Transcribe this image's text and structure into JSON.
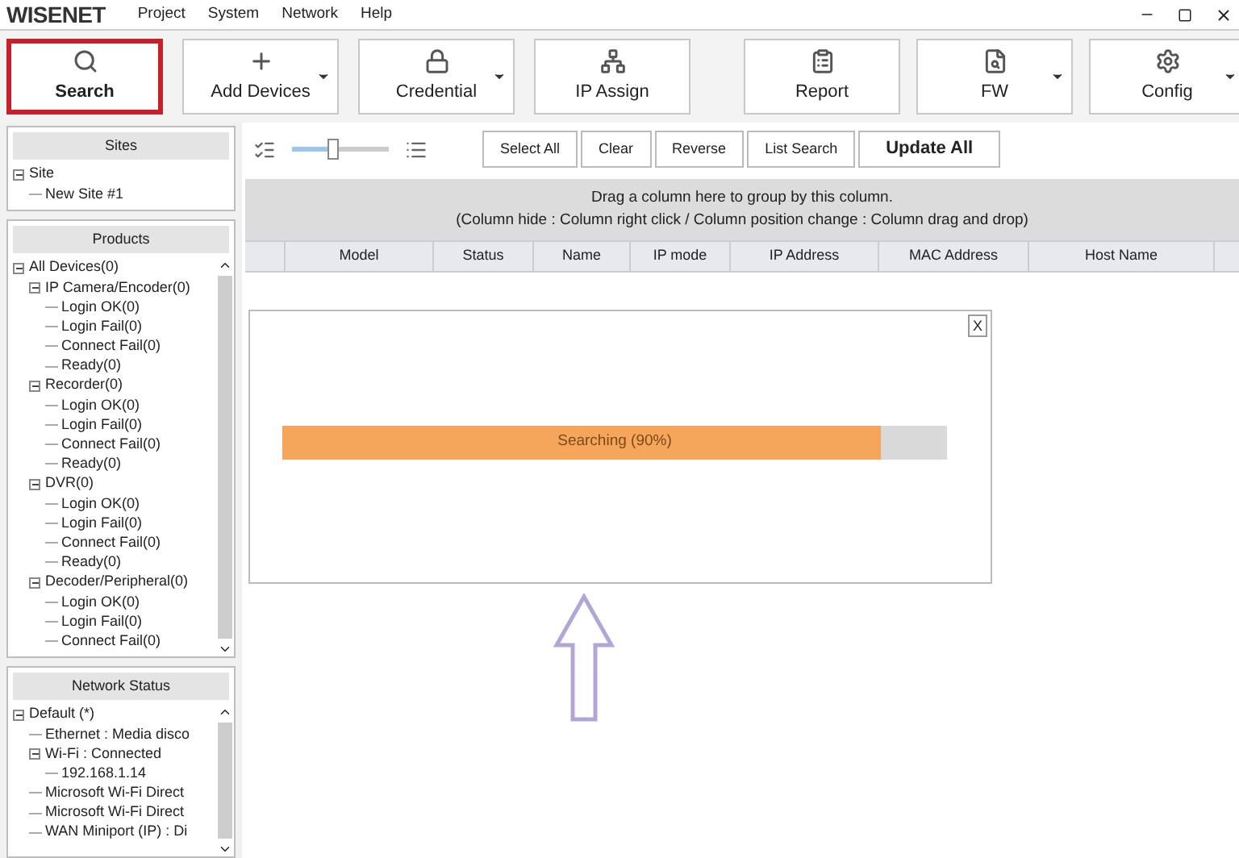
{
  "app": {
    "logo": "WISENET"
  },
  "menu": [
    "Project",
    "System",
    "Network",
    "Help"
  ],
  "toolbar": {
    "left": [
      {
        "label": "Search",
        "selected": true,
        "dropdown": false
      },
      {
        "label": "Add Devices",
        "selected": false,
        "dropdown": true
      },
      {
        "label": "Credential",
        "selected": false,
        "dropdown": true
      },
      {
        "label": "IP Assign",
        "selected": false,
        "dropdown": false
      }
    ],
    "right": [
      {
        "label": "Report",
        "selected": false,
        "dropdown": false
      },
      {
        "label": "FW",
        "selected": false,
        "dropdown": true
      },
      {
        "label": "Config",
        "selected": false,
        "dropdown": true
      }
    ]
  },
  "sites": {
    "title": "Sites",
    "tree": [
      {
        "label": "Site",
        "expanded": true,
        "children": [
          {
            "label": "New Site #1"
          }
        ]
      }
    ]
  },
  "products": {
    "title": "Products",
    "tree": [
      {
        "label": "All Devices(0)",
        "expanded": true,
        "children": [
          {
            "label": "IP Camera/Encoder(0)",
            "expanded": true,
            "children": [
              {
                "label": "Login OK(0)"
              },
              {
                "label": "Login Fail(0)"
              },
              {
                "label": "Connect Fail(0)"
              },
              {
                "label": "Ready(0)"
              }
            ]
          },
          {
            "label": "Recorder(0)",
            "expanded": true,
            "children": [
              {
                "label": "Login OK(0)"
              },
              {
                "label": "Login Fail(0)"
              },
              {
                "label": "Connect Fail(0)"
              },
              {
                "label": "Ready(0)"
              }
            ]
          },
          {
            "label": "DVR(0)",
            "expanded": true,
            "children": [
              {
                "label": "Login OK(0)"
              },
              {
                "label": "Login Fail(0)"
              },
              {
                "label": "Connect Fail(0)"
              },
              {
                "label": "Ready(0)"
              }
            ]
          },
          {
            "label": "Decoder/Peripheral(0)",
            "expanded": true,
            "children": [
              {
                "label": "Login OK(0)"
              },
              {
                "label": "Login Fail(0)"
              },
              {
                "label": "Connect Fail(0)"
              }
            ]
          }
        ]
      }
    ]
  },
  "network_status": {
    "title": "Network Status",
    "tree": [
      {
        "label": "Default (*)",
        "expanded": true,
        "children": [
          {
            "label": "Ethernet : Media disco"
          },
          {
            "label": "Wi-Fi : Connected",
            "expanded": true,
            "children": [
              {
                "label": "192.168.1.14"
              }
            ]
          },
          {
            "label": "Microsoft Wi-Fi Direct"
          },
          {
            "label": "Microsoft Wi-Fi Direct"
          },
          {
            "label": "WAN Miniport (IP) : Di"
          }
        ]
      }
    ]
  },
  "list_toolbar": {
    "zoom_slider": {
      "level": 0.42
    },
    "buttons": [
      {
        "label": "Select All",
        "primary": false
      },
      {
        "label": "Clear",
        "primary": false
      },
      {
        "label": "Reverse",
        "primary": false
      },
      {
        "label": "List Search",
        "primary": false
      },
      {
        "label": "Update All",
        "primary": true
      }
    ]
  },
  "group_panel": {
    "lines": [
      "Drag a column here to group by this column.",
      "(Column hide : Column right click / Column position change : Column drag and drop)"
    ]
  },
  "table": {
    "columns": [
      "Model",
      "Status",
      "Name",
      "IP mode",
      "IP Address",
      "MAC Address",
      "Host Name"
    ]
  },
  "progress_dialog": {
    "close": "X",
    "label": "Searching (90%)",
    "level": 0.9
  }
}
